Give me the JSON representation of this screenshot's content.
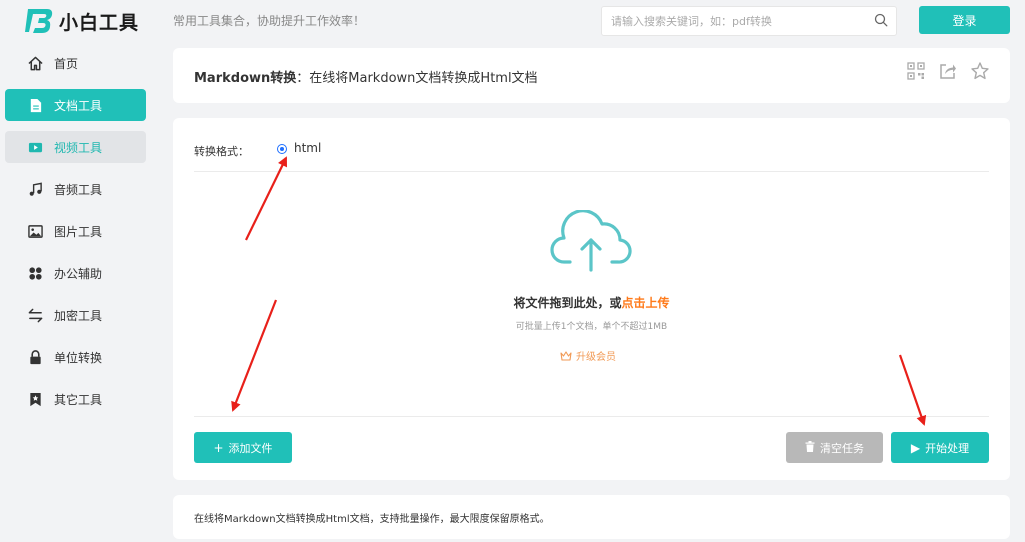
{
  "header": {
    "logo_text": "小白工具",
    "slogan": "常用工具集合，协助提升工作效率！",
    "search_placeholder": "请输入搜索关键词，如：pdf转换",
    "login_label": "登录"
  },
  "sidebar": {
    "items": [
      {
        "label": "首页",
        "icon": "home-icon"
      },
      {
        "label": "文档工具",
        "icon": "document-icon",
        "state": "active"
      },
      {
        "label": "视频工具",
        "icon": "video-icon",
        "state": "hover"
      },
      {
        "label": "音频工具",
        "icon": "music-icon"
      },
      {
        "label": "图片工具",
        "icon": "image-icon"
      },
      {
        "label": "办公辅助",
        "icon": "office-icon"
      },
      {
        "label": "加密工具",
        "icon": "swap-icon"
      },
      {
        "label": "单位转换",
        "icon": "lock-icon"
      },
      {
        "label": "其它工具",
        "icon": "bookmark-icon"
      }
    ]
  },
  "page": {
    "title_bold": "Markdown转换",
    "title_rest": "：在线将Markdown文档转换成Html文档",
    "title_icons": [
      "qrcode-icon",
      "share-icon",
      "star-icon"
    ]
  },
  "converter": {
    "format_label": "转换格式：",
    "format_option": "html",
    "drop_text": "将文件拖到此处，或",
    "drop_link": "点击上传",
    "drop_sub": "可批量上传1个文档，单个不超过1MB",
    "upgrade_label": "升级会员",
    "add_file_label": "添加文件",
    "clear_label": "清空任务",
    "start_label": "开始处理"
  },
  "description": "在线将Markdown文档转换成Html文档，支持批量操作，最大限度保留原格式。",
  "colors": {
    "accent": "#20c0b8",
    "link": "#ff7a1a",
    "upgrade": "#f19a56",
    "disabled": "#b8b8b8",
    "annotation_arrow": "#e8201a"
  }
}
